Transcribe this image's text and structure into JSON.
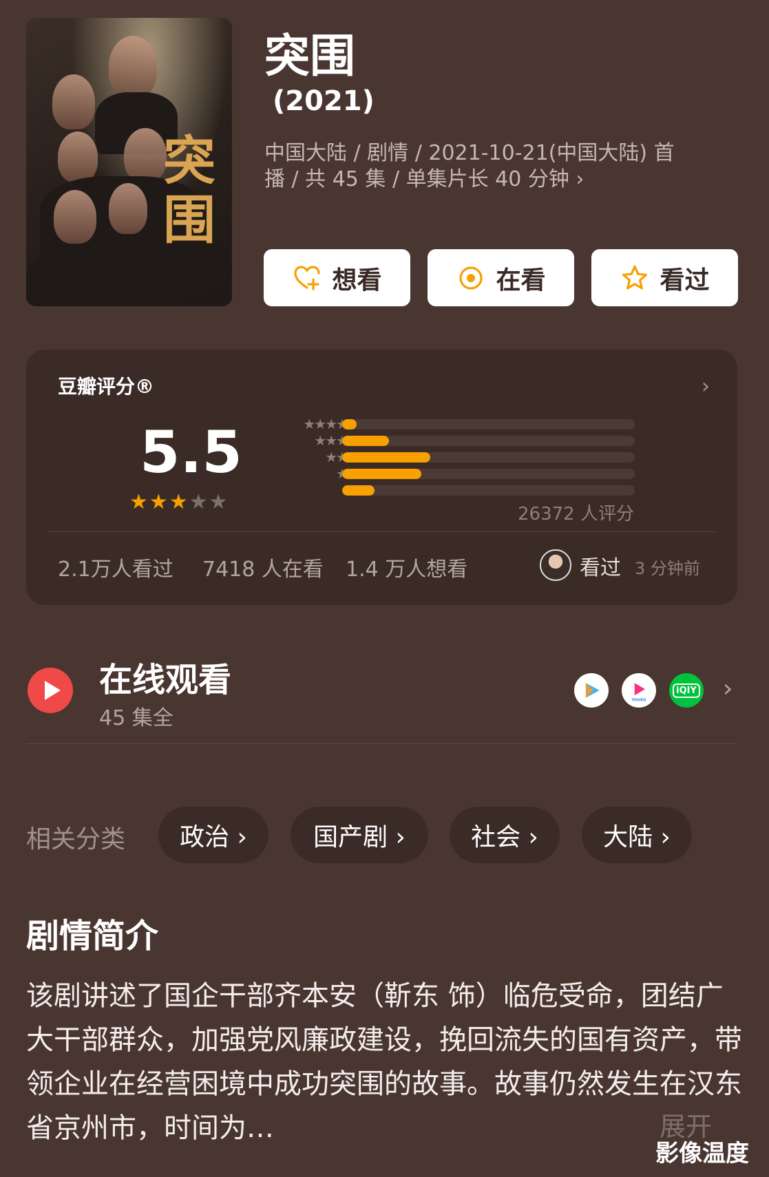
{
  "title": "突围",
  "year": "(2021)",
  "meta_line1": "中国大陆 / 剧情 / 2021-10-21(中国大陆) 首",
  "meta_line2": "播 / 共 45 集 / 单集片长 40 分钟 ›",
  "poster_title": "突围",
  "actions": [
    "想看",
    "在看",
    "看过"
  ],
  "rating": {
    "label": "豆瓣评分®",
    "score": "5.5",
    "stars_filled": 3,
    "stars_total": 5,
    "distribution_stars": [
      "★★★★★",
      "★★★★",
      "★★★",
      "★★",
      "★"
    ],
    "distribution": [
      0.05,
      0.16,
      0.3,
      0.27,
      0.11
    ],
    "count": "26372 人评分",
    "watched": "2.1万人看过",
    "watching": "7418 人在看",
    "want": "1.4 万人想看",
    "recent": "看过",
    "recent_time": "3 分钟前"
  },
  "online": {
    "title": "在线观看",
    "subtitle": "45 集全",
    "apps": [
      "腾讯视频",
      "YOUKU",
      "iQIY"
    ]
  },
  "tags_label": "相关分类",
  "tags": [
    "政治 ›",
    "国产剧 ›",
    "社会 ›",
    "大陆 ›"
  ],
  "synopsis_title": "剧情简介",
  "synopsis": "该剧讲述了国企干部齐本安（靳东 饰）临危受命，团结广大干部群众，加强党风廉政建设，挽回流失的国有资产，带领企业在经营困境中成功突围的故事。故事仍然发生在汉东省京州市，时间为…",
  "expand": "展开",
  "watermark": "影像温度",
  "colors": {
    "background": "#4a3631",
    "card": "#3b2b27",
    "accent": "#f7a000",
    "play": "#ef4a48"
  }
}
